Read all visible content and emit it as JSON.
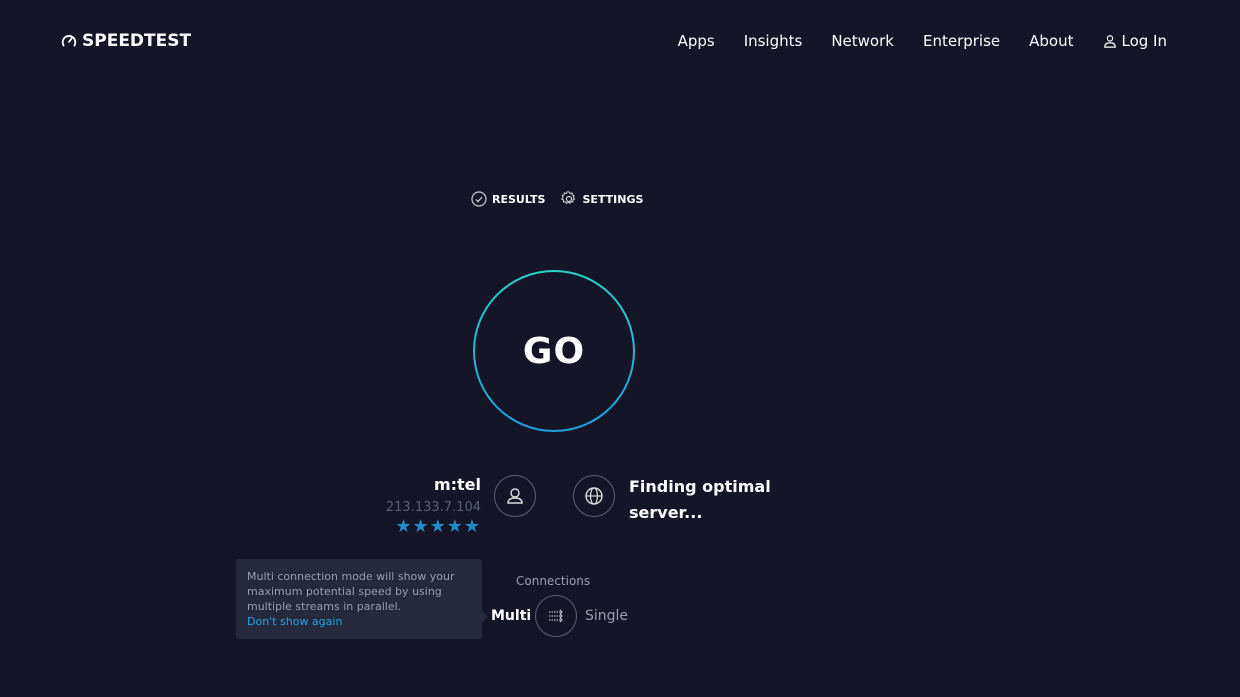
{
  "header": {
    "logo_text": "SPEEDTEST",
    "nav": [
      "Apps",
      "Insights",
      "Network",
      "Enterprise",
      "About"
    ],
    "login_label": "Log In"
  },
  "tabs": {
    "results": "RESULTS",
    "settings": "SETTINGS"
  },
  "go_label": "GO",
  "isp": {
    "name": "m:tel",
    "ip": "213.133.7.104",
    "rating": 5,
    "stars": "★★★★★"
  },
  "server_status": {
    "line1": "Finding optimal",
    "line2": "server..."
  },
  "tooltip": {
    "text": "Multi connection mode will show your maximum potential speed by using multiple streams in parallel.",
    "link": "Don't show again"
  },
  "connections": {
    "label": "Connections",
    "multi": "Multi",
    "single": "Single",
    "selected": "Multi"
  },
  "colors": {
    "background": "#141526",
    "accent_start": "#26d4c6",
    "accent_end": "#1d9fe0",
    "star": "#1f8cc7",
    "link": "#1fa5e6"
  }
}
